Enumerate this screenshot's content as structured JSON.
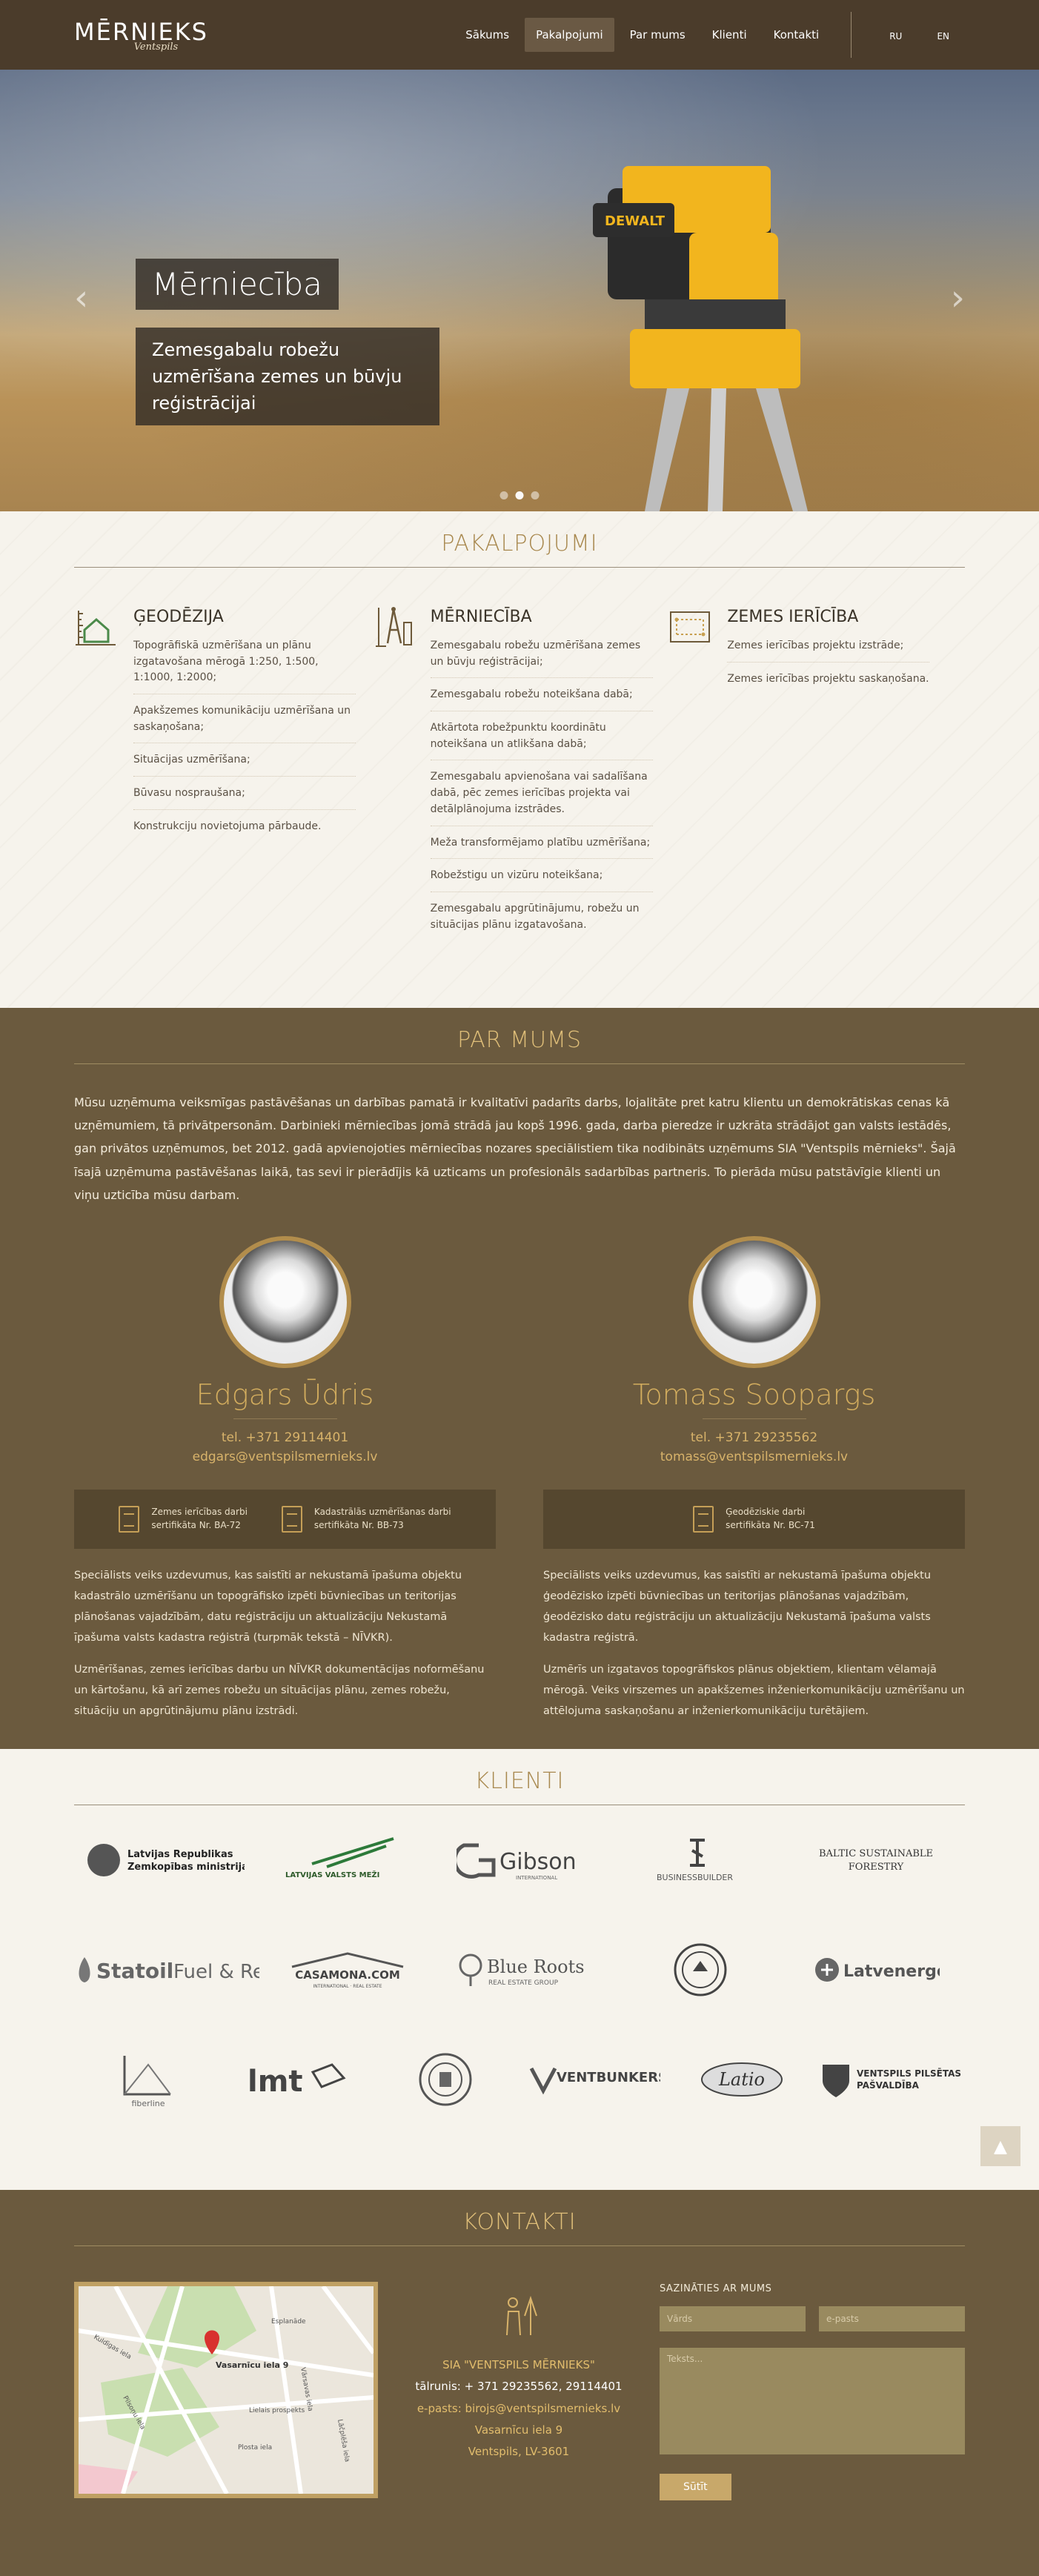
{
  "nav": {
    "logo_main": "MĒRNIEKS",
    "logo_sub": "Ventspils",
    "items": [
      {
        "label": "Sākums"
      },
      {
        "label": "Pakalpojumi"
      },
      {
        "label": "Par mums"
      },
      {
        "label": "Klienti"
      },
      {
        "label": "Kontakti"
      }
    ],
    "langs": [
      "RU",
      "EN"
    ]
  },
  "hero": {
    "title": "Mērniecība",
    "subtitle": "Zemesgabalu robežu uzmērīšana zemes un būvju reģistrācijai",
    "prev": "‹",
    "next": "›",
    "slide_count": 3,
    "active_slide": 2
  },
  "services": {
    "title": "PAKALPOJUMI",
    "columns": [
      {
        "heading": "ĢEODĒZIJA",
        "icon": "house-survey-icon",
        "items": [
          "Topogrāfiskā uzmērīšana un plānu izgatavošana mērogā 1:250, 1:500, 1:1000, 1:2000;",
          "Apakšzemes komunikāciju uzmērīšana un saskaņošana;",
          "Situācijas uzmērīšana;",
          "Būvasu nospraušana;",
          "Konstrukciju novietojuma pārbaude."
        ]
      },
      {
        "heading": "MĒRNIECĪBA",
        "icon": "drafting-tools-icon",
        "items": [
          "Zemesgabalu robežu uzmērīšana zemes un būvju reģistrācijai;",
          "Zemesgabalu robežu noteikšana dabā;",
          "Atkārtota robežpunktu koordinātu noteikšana un atlikšana dabā;",
          "Zemesgabalu apvienošana vai sadalīšana dabā, pēc zemes ierīcības projekta vai detālplānojuma izstrādes.",
          "Meža transformējamo platību uzmērīšana;",
          "Robežstigu un vizūru noteikšana;",
          "Zemesgabalu apgrūtinājumu, robežu un situācijas plānu izgatavošana."
        ]
      },
      {
        "heading": "ZEMES IERĪCĪBA",
        "icon": "land-plan-icon",
        "items": [
          "Zemes ierīcības projektu izstrāde;",
          "Zemes ierīcības projektu saskaņošana."
        ]
      }
    ]
  },
  "about": {
    "title": "PAR MUMS",
    "intro": "Mūsu uzņēmuma veiksmīgas pastāvēšanas un darbības pamatā ir kvalitatīvi padarīts darbs, lojalitāte pret katru klientu un demokrātiskas cenas kā uzņēmumiem, tā privātpersonām. Darbinieki mērniecības jomā strādā jau kopš 1996. gada, darba pieredze ir uzkrāta strādājot gan valsts iestādēs, gan privātos uzņēmumos, bet 2012. gadā apvienojoties mērniecības nozares speciālistiem tika nodibināts uzņēmums SIA \"Ventspils mērnieks\". Šajā īsajā uzņēmuma pastāvēšanas laikā, tas sevi ir pierādījis kā uzticams un profesionāls sadarbības partneris. To pierāda mūsu patstāvīgie klienti un viņu uzticība mūsu darbam.",
    "people": [
      {
        "name": "Edgars Ūdris",
        "phone": "tel. +371 29114401",
        "email": "edgars@ventspilsmernieks.lv",
        "certs": [
          {
            "line1": "Zemes ierīcības darbi",
            "line2": "sertifikāta Nr. BA-72"
          },
          {
            "line1": "Kadastrālās uzmērīšanas darbi",
            "line2": "sertifikāta Nr. BB-73"
          }
        ],
        "desc": [
          "Speciālists veiks uzdevumus, kas saistīti ar nekustamā īpašuma objektu kadastrālo uzmērīšanu un topogrāfisko izpēti būvniecības un teritorijas plānošanas vajadzībām, datu reģistrāciju un aktualizāciju Nekustamā īpašuma valsts kadastra reģistrā (turpmāk tekstā – NĪVKR).",
          "Uzmērīšanas, zemes ierīcības darbu un NĪVKR dokumentācijas noformēšanu un kārtošanu, kā arī zemes robežu un situācijas plānu, zemes robežu, situāciju un apgrūtinājumu plānu izstrādi."
        ]
      },
      {
        "name": "Tomass Soopargs",
        "phone": "tel. +371 29235562",
        "email": "tomass@ventspilsmernieks.lv",
        "certs": [
          {
            "line1": "Ģeodēziskie darbi",
            "line2": "sertifikāta Nr. BC-71"
          }
        ],
        "desc": [
          "Speciālists veiks uzdevumus, kas saistīti ar nekustamā īpašuma objektu ģeodēzisko izpēti būvniecības un teritorijas plānošanas vajadzībām, ģeodēzisko datu reģistrāciju un aktualizāciju Nekustamā īpašuma valsts kadastra reģistrā.",
          "Uzmērīs un izgatavos topogrāfiskos plānus objektiem, klientam vēlamajā mērogā. Veiks virszemes un apakšzemes inženierkomunikāciju uzmērīšanu un attēlojuma saskaņošanu ar inženierkomunikāciju turētājiem."
        ]
      }
    ]
  },
  "clients": {
    "title": "KLIENTI",
    "rows": [
      [
        {
          "name": "Latvijas Republikas Zemkopības ministrija",
          "line1": "Latvijas Republikas",
          "line2": "Zemkopības ministrija"
        },
        {
          "name": "Latvijas valsts meži",
          "line1": "LATVIJAS VALSTS MEŽI",
          "line2": ""
        },
        {
          "name": "Gibson",
          "line1": "Gibson",
          "line2": "INTERNATIONAL"
        },
        {
          "name": "Business Builder",
          "line1": "BUSINESSBUILDER",
          "line2": ""
        },
        {
          "name": "Baltic Sustainable Forestry",
          "line1": "BALTIC SUSTAINABLE",
          "line2": "FORESTRY"
        }
      ],
      [
        {
          "name": "Statoil Fuel & Retail",
          "line1": "Statoil",
          "line2": "Fuel & Retail"
        },
        {
          "name": "Casamona.com",
          "line1": "CASAMONA.COM",
          "line2": "INTERNATIONAL · REAL ESTATE"
        },
        {
          "name": "Blue Roots Real Estate Group",
          "line1": "Blue Roots",
          "line2": "REAL ESTATE GROUP"
        },
        {
          "name": "Seal badge",
          "line1": "",
          "line2": ""
        },
        {
          "name": "Latvenergo",
          "line1": "Latvenergo",
          "line2": ""
        }
      ],
      [
        {
          "name": "Fiberline",
          "line1": "fiberline",
          "line2": ""
        },
        {
          "name": "lmt",
          "line1": "lmt",
          "line2": ""
        },
        {
          "name": "Round seal",
          "line1": "",
          "line2": ""
        },
        {
          "name": "Ventbunkers",
          "line1": "VENTBUNKERS",
          "line2": ""
        },
        {
          "name": "Latio",
          "line1": "Latio",
          "line2": ""
        },
        {
          "name": "Ventspils pilsētas pašvaldība",
          "line1": "VENTSPILS PILSĒTAS",
          "line2": "PAŠVALDĪBA"
        }
      ]
    ],
    "to_top": "▲"
  },
  "contacts": {
    "title": "KONTAKTI",
    "map_label": "Vasarnīcu iela 9",
    "map_streets": [
      "Esplanāde",
      "Kuldīgas iela",
      "Lielais prospekts",
      "Pilsoņu iela",
      "Plosta iela",
      "Vārsavas iela",
      "Lāčplēša iela"
    ],
    "company": "SIA \"VENTSPILS MĒRNIEKS\"",
    "phone": "tālrunis: + 371 29235562, 29114401",
    "email": "e-pasts: birojs@ventspilsmernieks.lv",
    "street": "Vasarnīcu iela 9",
    "city": "Ventspils, LV-3601",
    "form_title": "SAZINĀTIES AR MUMS",
    "name_placeholder": "Vārds",
    "email_placeholder": "e-pasts",
    "message_placeholder": "Teksts...",
    "send_label": "Sūtīt"
  }
}
